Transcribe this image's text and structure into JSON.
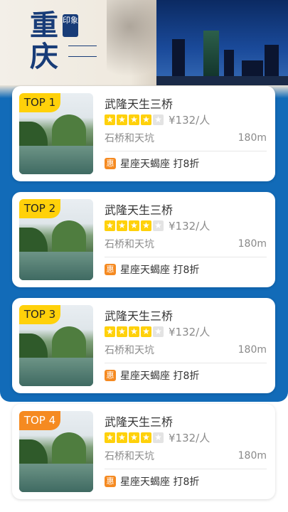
{
  "header": {
    "title": "重庆",
    "seal": "印象"
  },
  "colors": {
    "panel_blue": "#126bb8",
    "badge_yellow": "#ffd10a",
    "badge_orange": "#f58a21"
  },
  "spots": [
    {
      "rank": "TOP 1",
      "name": "武隆天生三桥",
      "rating": 4,
      "max_rating": 5,
      "price": "¥132/人",
      "desc": "石桥和天坑",
      "distance": "180m",
      "promo_icon": "惠",
      "promo": "星座天蝎座 打8折"
    },
    {
      "rank": "TOP 2",
      "name": "武隆天生三桥",
      "rating": 4,
      "max_rating": 5,
      "price": "¥132/人",
      "desc": "石桥和天坑",
      "distance": "180m",
      "promo_icon": "惠",
      "promo": "星座天蝎座 打8折"
    },
    {
      "rank": "TOP 3",
      "name": "武隆天生三桥",
      "rating": 4,
      "max_rating": 5,
      "price": "¥132/人",
      "desc": "石桥和天坑",
      "distance": "180m",
      "promo_icon": "惠",
      "promo": "星座天蝎座 打8折"
    },
    {
      "rank": "TOP 4",
      "name": "武隆天生三桥",
      "rating": 4,
      "max_rating": 5,
      "price": "¥132/人",
      "desc": "石桥和天坑",
      "distance": "180m",
      "promo_icon": "惠",
      "promo": "星座天蝎座 打8折"
    }
  ]
}
